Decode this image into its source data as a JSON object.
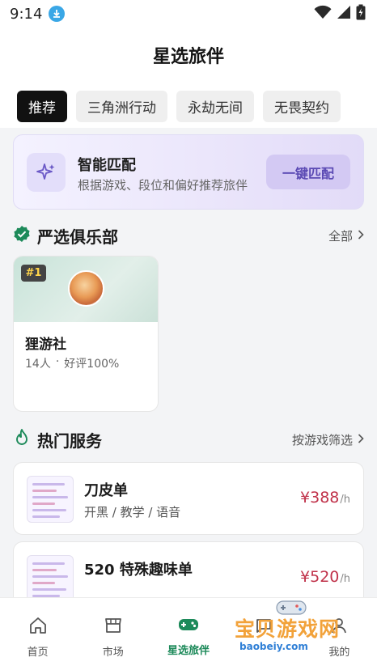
{
  "status_bar": {
    "time": "9:14"
  },
  "header": {
    "title": "星选旅伴",
    "tabs": [
      {
        "label": "推荐",
        "active": true
      },
      {
        "label": "三角洲行动",
        "active": false
      },
      {
        "label": "永劫无间",
        "active": false
      },
      {
        "label": "无畏契约",
        "active": false
      }
    ]
  },
  "smart_match": {
    "title": "智能匹配",
    "subtitle": "根据游戏、段位和偏好推荐旅伴",
    "button": "一键匹配"
  },
  "clubs_section": {
    "title": "严选俱乐部",
    "more": "全部",
    "clubs": [
      {
        "rank": "#1",
        "name": "狸游社",
        "members": "14人",
        "separator": "·",
        "rating": "好评100%"
      }
    ]
  },
  "services_section": {
    "title": "热门服务",
    "more": "按游戏筛选",
    "items": [
      {
        "name": "刀皮单",
        "tags": "开黑 / 教学 / 语音",
        "price": "¥388",
        "unit": "/h"
      },
      {
        "name": "520 特殊趣味单",
        "tags": "",
        "price": "¥520",
        "unit": "/h"
      }
    ]
  },
  "bottom_nav": {
    "items": [
      {
        "label": "首页",
        "icon": "home-icon",
        "active": false
      },
      {
        "label": "市场",
        "icon": "store-icon",
        "active": false
      },
      {
        "label": "星选旅伴",
        "icon": "gamepad-icon",
        "active": true
      },
      {
        "label": "",
        "icon": "message-icon",
        "active": false
      },
      {
        "label": "我的",
        "icon": "user-icon",
        "active": false
      }
    ]
  },
  "watermark": {
    "text": "宝贝游戏网",
    "url": "baobeiy.com"
  },
  "colors": {
    "accent": "#1d8a5a",
    "purple": "#5b4ab4",
    "price": "#c0324a"
  }
}
